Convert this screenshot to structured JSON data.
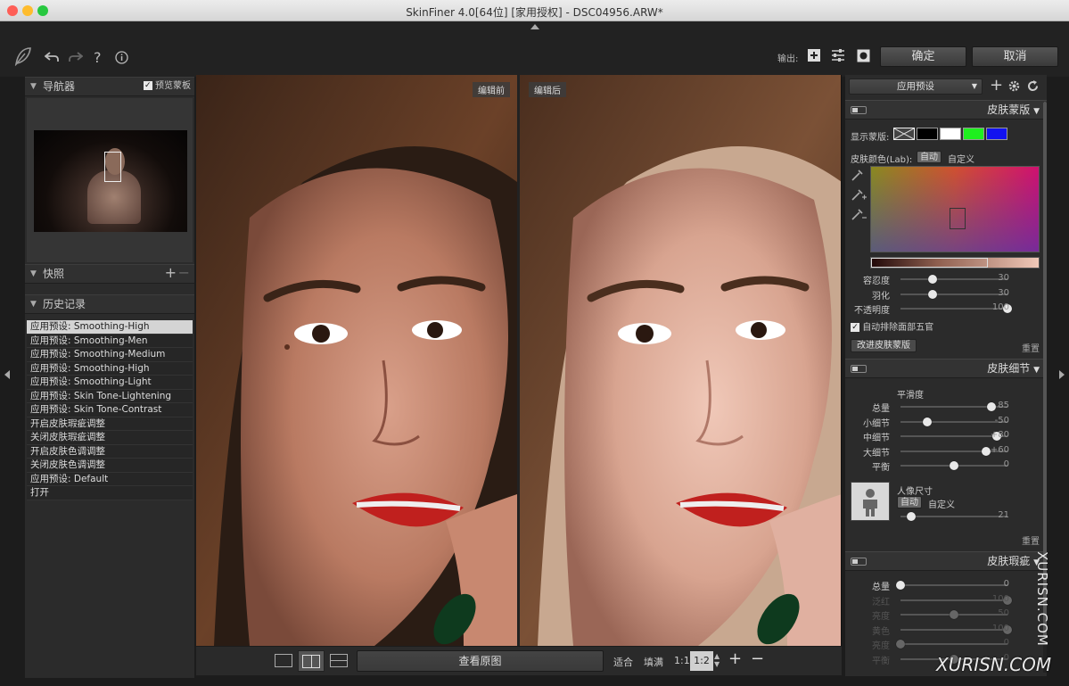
{
  "window": {
    "title": "SkinFiner 4.0[64位] [家用授权] - DSC04956.ARW*"
  },
  "toolbar": {
    "output_label": "输出:",
    "confirm_label": "确定",
    "cancel_label": "取消"
  },
  "navigator": {
    "title": "导航器",
    "preview_mask_label": "预览蒙板",
    "preview_mask_checked": true
  },
  "snapshot": {
    "title": "快照"
  },
  "history": {
    "title": "历史记录",
    "items": [
      {
        "label": "应用预设: Smoothing-High"
      },
      {
        "label": "应用预设: Smoothing-Men"
      },
      {
        "label": "应用预设: Smoothing-Medium"
      },
      {
        "label": "应用预设: Smoothing-High"
      },
      {
        "label": "应用预设: Smoothing-Light"
      },
      {
        "label": "应用预设: Skin Tone-Lightening"
      },
      {
        "label": "应用预设: Skin Tone-Contrast"
      },
      {
        "label": "开启皮肤瑕疵调整"
      },
      {
        "label": "关闭皮肤瑕疵调整"
      },
      {
        "label": "开启皮肤色调调整"
      },
      {
        "label": "关闭皮肤色调调整"
      },
      {
        "label": "应用预设: Default"
      },
      {
        "label": "打开"
      }
    ]
  },
  "viewer": {
    "before_label": "编辑前",
    "after_label": "编辑后"
  },
  "bottombar": {
    "view_original_label": "查看原图",
    "fit_label": "适合",
    "fill_label": "填满",
    "zoom_1_1": "1:1",
    "zoom_current": "1:2",
    "zoom_in": "+",
    "zoom_out": "−"
  },
  "preset": {
    "selected": "应用预设"
  },
  "skin_mask": {
    "title": "皮肤蒙版",
    "show_mask_label": "显示蒙版:",
    "skin_color_label": "皮肤颜色(Lab):",
    "auto_label": "自动",
    "custom_label": "自定义",
    "sliders": [
      {
        "label": "容忍度",
        "value": "30",
        "level": 0.3
      },
      {
        "label": "羽化",
        "value": "30",
        "level": 0.3
      },
      {
        "label": "不透明度",
        "value": "100",
        "level": 1.0
      }
    ],
    "auto_exclude_label": "自动排除面部五官",
    "auto_exclude_checked": true,
    "improve_button": "改进皮肤蒙版",
    "reset_label": "重置"
  },
  "skin_detail": {
    "title": "皮肤细节",
    "smoothness_label": "平滑度",
    "sliders": [
      {
        "label": "总量",
        "value": "85",
        "level": 0.85
      },
      {
        "label": "小细节",
        "value": "-50",
        "level": 0.25
      },
      {
        "label": "中细节",
        "value": "+80",
        "level": 0.9
      },
      {
        "label": "大细节",
        "value": "+60",
        "level": 0.8
      },
      {
        "label": "平衡",
        "value": "0",
        "level": 0.5
      }
    ],
    "portrait_size_label": "人像尺寸",
    "auto_label": "自动",
    "custom_label": "自定义",
    "portrait_value": "21",
    "portrait_level": 0.1,
    "reset_label": "重置"
  },
  "skin_blemish": {
    "title": "皮肤瑕疵",
    "sliders": [
      {
        "label": "总量",
        "value": "0",
        "level": 0.0,
        "enabled": true
      },
      {
        "label": "泛红",
        "value": "100",
        "level": 1.0,
        "enabled": false
      },
      {
        "label": "亮度",
        "value": "50",
        "level": 0.5,
        "enabled": false
      },
      {
        "label": "黄色",
        "value": "100",
        "level": 1.0,
        "enabled": false
      },
      {
        "label": "亮度",
        "value": "0",
        "level": 0.0,
        "enabled": false
      },
      {
        "label": "平衡",
        "value": "0",
        "level": 0.5,
        "enabled": false
      }
    ]
  },
  "watermark": {
    "vertical": "XURISN.COM",
    "horizontal": "XURISN.COM"
  },
  "colors": {
    "accent_red": "#c0201e",
    "panel_bg": "#2b2b2b",
    "selected_row": "#d4d4d4"
  }
}
